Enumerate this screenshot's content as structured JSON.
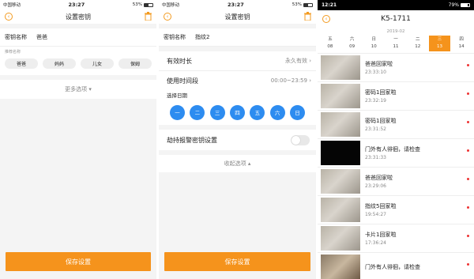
{
  "screen1": {
    "status": {
      "carrier": "中国移动",
      "time": "23:27",
      "battery": "53%"
    },
    "title": "设置密钥",
    "name_label": "密钥名称",
    "name_value": "爸爸",
    "recommend_label": "推荐名称",
    "chips": [
      "爸爸",
      "妈妈",
      "儿女",
      "保姆"
    ],
    "more": "更多选项",
    "save": "保存设置"
  },
  "screen2": {
    "status": {
      "carrier": "中国移动",
      "time": "23:27",
      "battery": "53%"
    },
    "title": "设置密钥",
    "name_label": "密钥名称",
    "name_value": "指纹2",
    "duration_label": "有效时长",
    "duration_value": "永久有效",
    "timeslot_label": "使用时间段",
    "timeslot_value": "00:00~23:59",
    "date_label": "选择日期",
    "weekdays": [
      "一",
      "二",
      "三",
      "四",
      "五",
      "六",
      "日"
    ],
    "duress_label": "劫持报警密钥设置",
    "collapse": "收起选项",
    "save": "保存设置"
  },
  "screen3": {
    "status": {
      "time": "12:21",
      "battery": "79%"
    },
    "device": "K5-1711",
    "month": "2019-02",
    "days": [
      {
        "w": "五",
        "d": "08"
      },
      {
        "w": "六",
        "d": "09"
      },
      {
        "w": "日",
        "d": "10"
      },
      {
        "w": "一",
        "d": "11"
      },
      {
        "w": "二",
        "d": "12"
      },
      {
        "w": "三",
        "d": "13"
      },
      {
        "w": "四",
        "d": "14"
      }
    ],
    "events": [
      {
        "title": "爸爸回家啦",
        "time": "23:33:10"
      },
      {
        "title": "密码1回家啦",
        "time": "23:32:19"
      },
      {
        "title": "密码1回家啦",
        "time": "23:31:52"
      },
      {
        "title": "门外有人徘徊，请检查",
        "time": "23:31:33"
      },
      {
        "title": "爸爸回家啦",
        "time": "23:29:06"
      },
      {
        "title": "指纹5回家啦",
        "time": "19:54:27"
      },
      {
        "title": "卡片1回家啦",
        "time": "17:36:24"
      },
      {
        "title": "门外有人徘徊，请检查",
        "time": ""
      }
    ]
  },
  "colors": {
    "accent": "#f5931c",
    "weekday_blue": "#2d8cf0",
    "alert_red": "#e33333"
  }
}
